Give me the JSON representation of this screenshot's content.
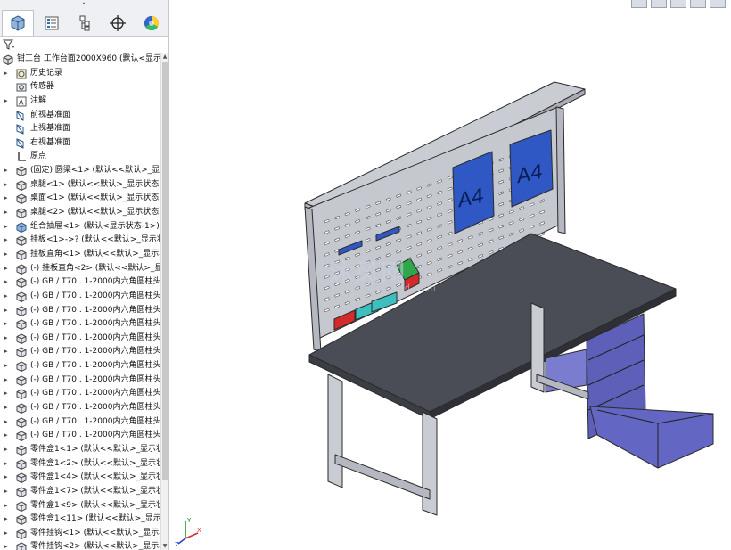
{
  "panel": {
    "tabs": [
      {
        "name": "tab-feature-manager",
        "icon": "cube-tree-icon"
      },
      {
        "name": "tab-property-manager",
        "icon": "list-icon"
      },
      {
        "name": "tab-configuration-manager",
        "icon": "config-icon"
      },
      {
        "name": "tab-dimxpert",
        "icon": "crosshair-icon"
      },
      {
        "name": "tab-display-manager",
        "icon": "color-wheel-icon"
      }
    ],
    "tree": [
      {
        "indent": 0,
        "twisty": "",
        "icon": "assembly-icon",
        "label": "钳工台 工作台面2000X960 (默认<显示状"
      },
      {
        "indent": 1,
        "twisty": "▸",
        "icon": "history-icon",
        "label": "历史记录"
      },
      {
        "indent": 1,
        "twisty": "",
        "icon": "sensor-icon",
        "label": "传感器"
      },
      {
        "indent": 1,
        "twisty": "▸",
        "icon": "annotation-icon",
        "label": "注解"
      },
      {
        "indent": 1,
        "twisty": "",
        "icon": "plane-icon",
        "label": "前视基准面"
      },
      {
        "indent": 1,
        "twisty": "",
        "icon": "plane-icon",
        "label": "上视基准面"
      },
      {
        "indent": 1,
        "twisty": "",
        "icon": "plane-icon",
        "label": "右视基准面"
      },
      {
        "indent": 1,
        "twisty": "",
        "icon": "origin-icon",
        "label": "原点"
      },
      {
        "indent": 1,
        "twisty": "▸",
        "icon": "part-icon",
        "label": "(固定) 圆梁<1> (默认<<默认>_显示状"
      },
      {
        "indent": 1,
        "twisty": "▸",
        "icon": "part-icon",
        "label": "桌腿<1> (默认<<默认>_显示状态 1>"
      },
      {
        "indent": 1,
        "twisty": "▸",
        "icon": "part-icon",
        "label": "桌面<1> (默认<<默认>_显示状态 1>"
      },
      {
        "indent": 1,
        "twisty": "▸",
        "icon": "part-icon",
        "label": "桌腿<2> (默认<<默认>_显示状态 1>"
      },
      {
        "indent": 1,
        "twisty": "▸",
        "icon": "subassembly-icon",
        "label": "组合抽屉<1> (默认<显示状态-1>)"
      },
      {
        "indent": 1,
        "twisty": "▸",
        "icon": "part-icon",
        "label": "挂板<1>->? (默认<<默认>_显示状态"
      },
      {
        "indent": 1,
        "twisty": "▸",
        "icon": "part-icon",
        "label": "挂板直角<1> (默认<<默认>_显示状态"
      },
      {
        "indent": 1,
        "twisty": "▸",
        "icon": "part-icon",
        "label": "(-) 挂板直角<2> (默认<<默认>_显示"
      },
      {
        "indent": 1,
        "twisty": "▸",
        "icon": "part-icon",
        "label": "(-) GB / T70 . 1-2000内六角圆柱头螺"
      },
      {
        "indent": 1,
        "twisty": "▸",
        "icon": "part-icon",
        "label": "(-) GB / T70 . 1-2000内六角圆柱头螺"
      },
      {
        "indent": 1,
        "twisty": "▸",
        "icon": "part-icon",
        "label": "(-) GB / T70 . 1-2000内六角圆柱头螺"
      },
      {
        "indent": 1,
        "twisty": "▸",
        "icon": "part-icon",
        "label": "(-) GB / T70 . 1-2000内六角圆柱头螺"
      },
      {
        "indent": 1,
        "twisty": "▸",
        "icon": "part-icon",
        "label": "(-) GB / T70 . 1-2000内六角圆柱头螺"
      },
      {
        "indent": 1,
        "twisty": "▸",
        "icon": "part-icon",
        "label": "(-) GB / T70 . 1-2000内六角圆柱头螺"
      },
      {
        "indent": 1,
        "twisty": "▸",
        "icon": "part-icon",
        "label": "(-) GB / T70 . 1-2000内六角圆柱头螺"
      },
      {
        "indent": 1,
        "twisty": "▸",
        "icon": "part-icon",
        "label": "(-) GB / T70 . 1-2000内六角圆柱头螺"
      },
      {
        "indent": 1,
        "twisty": "▸",
        "icon": "part-icon",
        "label": "(-) GB / T70 . 1-2000内六角圆柱头螺"
      },
      {
        "indent": 1,
        "twisty": "▸",
        "icon": "part-icon",
        "label": "(-) GB / T70 . 1-2000内六角圆柱头螺"
      },
      {
        "indent": 1,
        "twisty": "▸",
        "icon": "part-icon",
        "label": "(-) GB / T70 . 1-2000内六角圆柱头螺"
      },
      {
        "indent": 1,
        "twisty": "▸",
        "icon": "part-icon",
        "label": "(-) GB / T70 . 1-2000内六角圆柱头螺"
      },
      {
        "indent": 1,
        "twisty": "▸",
        "icon": "part-icon",
        "label": "零件盒1<1> (默认<<默认>_显示状态"
      },
      {
        "indent": 1,
        "twisty": "▸",
        "icon": "part-icon",
        "label": "零件盒1<2> (默认<<默认>_显示状态"
      },
      {
        "indent": 1,
        "twisty": "▸",
        "icon": "part-icon",
        "label": "零件盒1<4> (默认<<默认>_显示状态"
      },
      {
        "indent": 1,
        "twisty": "▸",
        "icon": "part-icon",
        "label": "零件盒1<7> (默认<<默认>_显示状态"
      },
      {
        "indent": 1,
        "twisty": "▸",
        "icon": "part-icon",
        "label": "零件盒1<9> (默认<<默认>_显示状态"
      },
      {
        "indent": 1,
        "twisty": "▸",
        "icon": "part-icon",
        "label": "零件盒1<11> (默认<<默认>_显示状"
      },
      {
        "indent": 1,
        "twisty": "▸",
        "icon": "part-icon",
        "label": "零件挂钩<1> (默认<<默认>_显示状态"
      },
      {
        "indent": 1,
        "twisty": "▸",
        "icon": "part-icon",
        "label": "零件挂钩<2> (默认<<默认>_显示状"
      }
    ]
  },
  "viewport": {
    "sign_left": "A4",
    "sign_right": "A4",
    "watermark": "沐风网",
    "watermark_url": "www.mfcad.com",
    "triad": {
      "x": "X",
      "y": "Y",
      "z": "Z"
    }
  },
  "colors": {
    "panel_bg": "#ffffff",
    "tabs_bg": "#eef0f3",
    "part_gray": "#c9ccd3",
    "part_edge": "#2b2b2b",
    "tabletop": "#4a4d55",
    "drawer_blue": "#5d5fb8",
    "sign_blue": "#2f58c4",
    "bin_red": "#d42a2a",
    "bin_teal": "#3dbfbf",
    "bin_green": "#2ea84a"
  }
}
